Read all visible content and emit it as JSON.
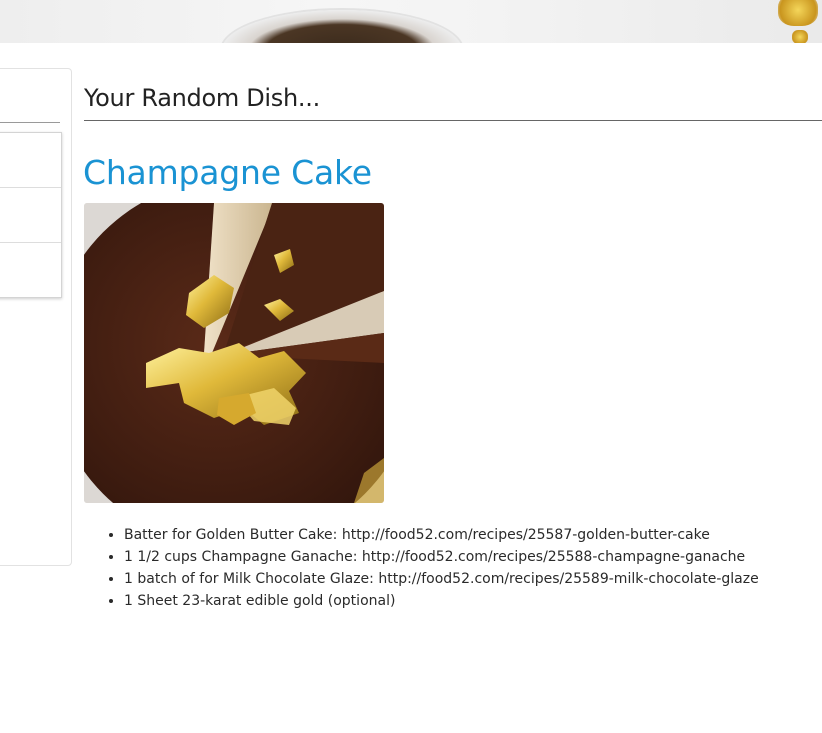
{
  "page": {
    "title": "Your Random Dish..."
  },
  "dish": {
    "name": "Champagne Cake",
    "image_alt": "Chocolate cake with gold leaf"
  },
  "ingredients": [
    "Batter for Golden Butter Cake: http://food52.com/recipes/25587-golden-butter-cake",
    "1 1/2 cups Champagne Ganache: http://food52.com/recipes/25588-champagne-ganache",
    "1 batch of for Milk Chocolate Glaze: http://food52.com/recipes/25589-milk-chocolate-glaze",
    "1 Sheet 23-karat edible gold (optional)"
  ],
  "sidebar": {
    "items": [
      "",
      "",
      ""
    ]
  },
  "colors": {
    "link": "#1a93d3",
    "chocolate": "#3e1c10",
    "gold": "#d9b22e"
  }
}
